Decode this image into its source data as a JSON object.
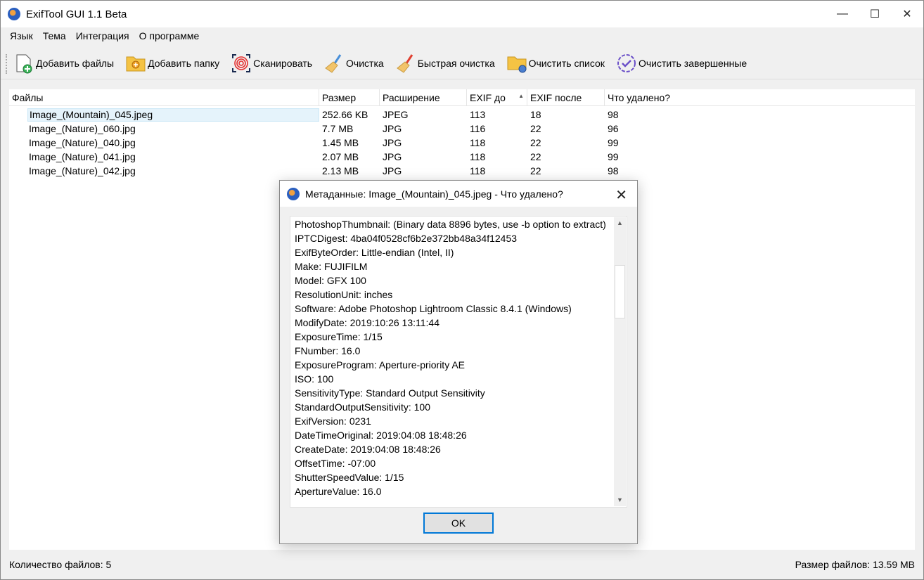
{
  "window": {
    "title": "ExifTool GUI 1.1 Beta",
    "minimize": "—",
    "maximize": "☐",
    "close": "✕"
  },
  "menu": [
    "Язык",
    "Тема",
    "Интеграция",
    "О программе"
  ],
  "toolbar": [
    {
      "label": "Добавить файлы",
      "icon": "add-file-icon"
    },
    {
      "label": "Добавить папку",
      "icon": "add-folder-icon"
    },
    {
      "label": "Сканировать",
      "icon": "fingerprint-icon"
    },
    {
      "label": "Очистка",
      "icon": "broom-icon"
    },
    {
      "label": "Быстрая очистка",
      "icon": "red-broom-icon"
    },
    {
      "label": "Очистить список",
      "icon": "clear-list-folder-icon"
    },
    {
      "label": "Очистить завершенные",
      "icon": "check-circle-icon"
    }
  ],
  "table": {
    "columns": [
      "Файлы",
      "Размер",
      "Расширение",
      "EXIF до",
      "EXIF после",
      "Что удалено?"
    ],
    "sort_column": "EXIF до",
    "rows": [
      [
        "Image_(Mountain)_045.jpeg",
        "252.66 KB",
        "JPEG",
        "113",
        "18",
        "98"
      ],
      [
        "Image_(Nature)_060.jpg",
        "7.7 MB",
        "JPG",
        "116",
        "22",
        "96"
      ],
      [
        "Image_(Nature)_040.jpg",
        "1.45 MB",
        "JPG",
        "118",
        "22",
        "99"
      ],
      [
        "Image_(Nature)_041.jpg",
        "2.07 MB",
        "JPG",
        "118",
        "22",
        "99"
      ],
      [
        "Image_(Nature)_042.jpg",
        "2.13 MB",
        "JPG",
        "118",
        "22",
        "98"
      ]
    ]
  },
  "status": {
    "count": "Количество файлов: 5",
    "size": "Размер файлов: 13.59 MB"
  },
  "dialog": {
    "title": "Метаданные: Image_(Mountain)_045.jpeg - Что удалено?",
    "ok": "OK",
    "lines": [
      "PhotoshopThumbnail: (Binary data 8896 bytes, use -b option to extract)",
      "IPTCDigest: 4ba04f0528cf6b2e372bb48a34f12453",
      "ExifByteOrder: Little-endian (Intel, II)",
      "Make: FUJIFILM",
      "Model: GFX 100",
      "ResolutionUnit: inches",
      "Software: Adobe Photoshop Lightroom Classic 8.4.1 (Windows)",
      "ModifyDate: 2019:10:26 13:11:44",
      "ExposureTime: 1/15",
      "FNumber: 16.0",
      "ExposureProgram: Aperture-priority AE",
      "ISO: 100",
      "SensitivityType: Standard Output Sensitivity",
      "StandardOutputSensitivity: 100",
      "ExifVersion: 0231",
      "DateTimeOriginal: 2019:04:08 18:48:26",
      "CreateDate: 2019:04:08 18:48:26",
      "OffsetTime: -07:00",
      "ShutterSpeedValue: 1/15",
      "ApertureValue: 16.0"
    ]
  }
}
